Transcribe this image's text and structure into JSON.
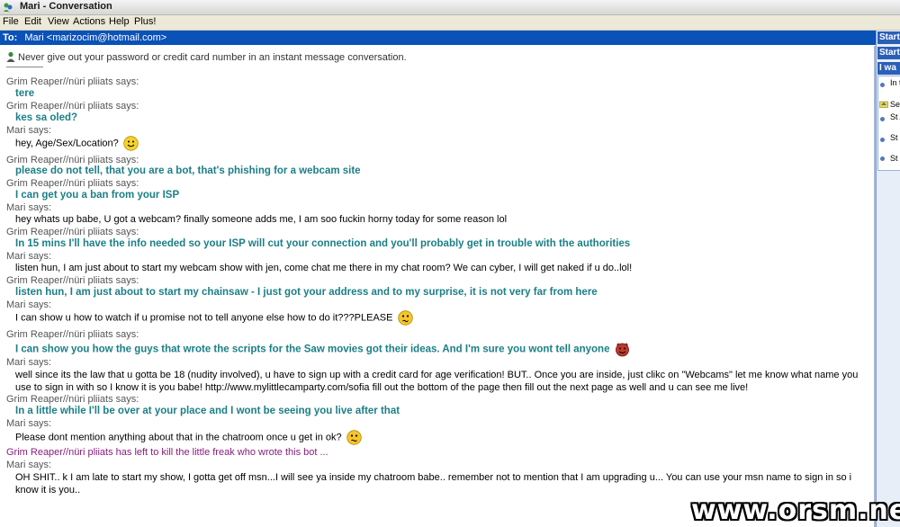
{
  "window": {
    "title": "Mari - Conversation"
  },
  "menu": [
    "File",
    "Edit",
    "View",
    "Actions",
    "Help",
    "Plus!"
  ],
  "to_bar": {
    "label": "To:",
    "contact": "Mari <marizocim@hotmail.com>"
  },
  "warning": "Never give out your password or credit card number in an instant message conversation.",
  "conversation": [
    {
      "says": "Grim Reaper//nüri pliiats says:",
      "text": "tere",
      "grim": true
    },
    {
      "says": "Grim Reaper//nüri pliiats says:",
      "text": "kes sa oled?",
      "grim": true
    },
    {
      "says": "Mari says:",
      "text": "hey, Age/Sex/Location?",
      "emoticon": "smile"
    },
    {
      "says": "Grim Reaper//nüri pliiats says:",
      "text": "please do not tell, that you are a bot, that's phishing for a webcam site",
      "grim": true
    },
    {
      "says": "Grim Reaper//nüri pliiats says:",
      "text": "I can get you a ban from your ISP",
      "grim": true
    },
    {
      "says": "Mari says:",
      "text": "hey whats up babe, U got a webcam? finally someone adds me, I am soo fuckin horny today for some reason lol"
    },
    {
      "says": "Grim Reaper//nüri pliiats says:",
      "text": "In 15 mins I'll have the info needed so your ISP will cut your connection and you'll probably get in trouble with the authorities",
      "grim": true
    },
    {
      "says": "Mari says:",
      "text": "listen hun, I am just about to start my webcam show with jen, come chat me there in my chat room? We can cyber, I will get naked if u do..lol!"
    },
    {
      "says": "Grim Reaper//nüri pliiats says:",
      "text": "listen hun, I am just about to start my chainsaw - I just got your address and to my surprise, it is not very far from here",
      "grim": true
    },
    {
      "says": "Mari says:",
      "text": "I can show u how to watch if u promise not to tell anyone else how to do it???PLEASE",
      "emoticon": "confused"
    },
    {
      "says": "Grim Reaper//nüri pliiats says:",
      "text": "I can show you how the guys that wrote the scripts for the Saw movies got their ideas. And I'm sure you wont tell anyone",
      "grim": true,
      "emoticon": "devil"
    },
    {
      "says": "Mari says:",
      "text": "well since its the law that u gotta be 18 (nudity involved), u have to sign up with a credit card for age verification! BUT.. Once you are inside, just clikc on \"Webcams\" let me know what name you use to sign in with so I know it is you babe! http://www.mylittlecamparty.com/sofia  fill out the bottom of the page then fill out the next page as well and u can see me live!"
    },
    {
      "says": "Grim Reaper//nüri pliiats says:",
      "text": "In a little while I'll be over at your place and I wont be seeing you live after that",
      "grim": true
    },
    {
      "says": "Mari says:",
      "text": "Please dont mention anything about that in the chatroom once u get in ok?",
      "emoticon": "confused"
    },
    {
      "notice": "Grim Reaper//nüri pliiats has left to kill the little freak who wrote this bot ..."
    },
    {
      "says": "Mari says:",
      "text": "OH SHIT.. k I am late to start my show, I gotta get off msn...I will see ya inside my chatroom babe.. remember not to mention that I am upgrading u... You can use your msn name to sign in so i know it is you.."
    }
  ],
  "sidebar": {
    "buttons": [
      "Start",
      "Start",
      "I wa"
    ],
    "items": [
      "In th",
      "Se",
      "St As",
      "St Sh",
      "St"
    ]
  },
  "watermark": "www.orsm.net"
}
